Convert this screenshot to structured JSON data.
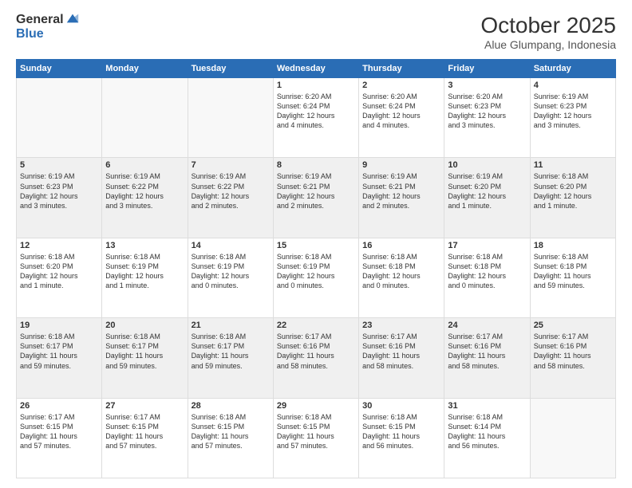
{
  "logo": {
    "general": "General",
    "blue": "Blue"
  },
  "title": {
    "month": "October 2025",
    "location": "Alue Glumpang, Indonesia"
  },
  "headers": [
    "Sunday",
    "Monday",
    "Tuesday",
    "Wednesday",
    "Thursday",
    "Friday",
    "Saturday"
  ],
  "weeks": [
    [
      {
        "day": "",
        "info": ""
      },
      {
        "day": "",
        "info": ""
      },
      {
        "day": "",
        "info": ""
      },
      {
        "day": "1",
        "info": "Sunrise: 6:20 AM\nSunset: 6:24 PM\nDaylight: 12 hours\nand 4 minutes."
      },
      {
        "day": "2",
        "info": "Sunrise: 6:20 AM\nSunset: 6:24 PM\nDaylight: 12 hours\nand 4 minutes."
      },
      {
        "day": "3",
        "info": "Sunrise: 6:20 AM\nSunset: 6:23 PM\nDaylight: 12 hours\nand 3 minutes."
      },
      {
        "day": "4",
        "info": "Sunrise: 6:19 AM\nSunset: 6:23 PM\nDaylight: 12 hours\nand 3 minutes."
      }
    ],
    [
      {
        "day": "5",
        "info": "Sunrise: 6:19 AM\nSunset: 6:23 PM\nDaylight: 12 hours\nand 3 minutes."
      },
      {
        "day": "6",
        "info": "Sunrise: 6:19 AM\nSunset: 6:22 PM\nDaylight: 12 hours\nand 3 minutes."
      },
      {
        "day": "7",
        "info": "Sunrise: 6:19 AM\nSunset: 6:22 PM\nDaylight: 12 hours\nand 2 minutes."
      },
      {
        "day": "8",
        "info": "Sunrise: 6:19 AM\nSunset: 6:21 PM\nDaylight: 12 hours\nand 2 minutes."
      },
      {
        "day": "9",
        "info": "Sunrise: 6:19 AM\nSunset: 6:21 PM\nDaylight: 12 hours\nand 2 minutes."
      },
      {
        "day": "10",
        "info": "Sunrise: 6:19 AM\nSunset: 6:20 PM\nDaylight: 12 hours\nand 1 minute."
      },
      {
        "day": "11",
        "info": "Sunrise: 6:18 AM\nSunset: 6:20 PM\nDaylight: 12 hours\nand 1 minute."
      }
    ],
    [
      {
        "day": "12",
        "info": "Sunrise: 6:18 AM\nSunset: 6:20 PM\nDaylight: 12 hours\nand 1 minute."
      },
      {
        "day": "13",
        "info": "Sunrise: 6:18 AM\nSunset: 6:19 PM\nDaylight: 12 hours\nand 1 minute."
      },
      {
        "day": "14",
        "info": "Sunrise: 6:18 AM\nSunset: 6:19 PM\nDaylight: 12 hours\nand 0 minutes."
      },
      {
        "day": "15",
        "info": "Sunrise: 6:18 AM\nSunset: 6:19 PM\nDaylight: 12 hours\nand 0 minutes."
      },
      {
        "day": "16",
        "info": "Sunrise: 6:18 AM\nSunset: 6:18 PM\nDaylight: 12 hours\nand 0 minutes."
      },
      {
        "day": "17",
        "info": "Sunrise: 6:18 AM\nSunset: 6:18 PM\nDaylight: 12 hours\nand 0 minutes."
      },
      {
        "day": "18",
        "info": "Sunrise: 6:18 AM\nSunset: 6:18 PM\nDaylight: 11 hours\nand 59 minutes."
      }
    ],
    [
      {
        "day": "19",
        "info": "Sunrise: 6:18 AM\nSunset: 6:17 PM\nDaylight: 11 hours\nand 59 minutes."
      },
      {
        "day": "20",
        "info": "Sunrise: 6:18 AM\nSunset: 6:17 PM\nDaylight: 11 hours\nand 59 minutes."
      },
      {
        "day": "21",
        "info": "Sunrise: 6:18 AM\nSunset: 6:17 PM\nDaylight: 11 hours\nand 59 minutes."
      },
      {
        "day": "22",
        "info": "Sunrise: 6:17 AM\nSunset: 6:16 PM\nDaylight: 11 hours\nand 58 minutes."
      },
      {
        "day": "23",
        "info": "Sunrise: 6:17 AM\nSunset: 6:16 PM\nDaylight: 11 hours\nand 58 minutes."
      },
      {
        "day": "24",
        "info": "Sunrise: 6:17 AM\nSunset: 6:16 PM\nDaylight: 11 hours\nand 58 minutes."
      },
      {
        "day": "25",
        "info": "Sunrise: 6:17 AM\nSunset: 6:16 PM\nDaylight: 11 hours\nand 58 minutes."
      }
    ],
    [
      {
        "day": "26",
        "info": "Sunrise: 6:17 AM\nSunset: 6:15 PM\nDaylight: 11 hours\nand 57 minutes."
      },
      {
        "day": "27",
        "info": "Sunrise: 6:17 AM\nSunset: 6:15 PM\nDaylight: 11 hours\nand 57 minutes."
      },
      {
        "day": "28",
        "info": "Sunrise: 6:18 AM\nSunset: 6:15 PM\nDaylight: 11 hours\nand 57 minutes."
      },
      {
        "day": "29",
        "info": "Sunrise: 6:18 AM\nSunset: 6:15 PM\nDaylight: 11 hours\nand 57 minutes."
      },
      {
        "day": "30",
        "info": "Sunrise: 6:18 AM\nSunset: 6:15 PM\nDaylight: 11 hours\nand 56 minutes."
      },
      {
        "day": "31",
        "info": "Sunrise: 6:18 AM\nSunset: 6:14 PM\nDaylight: 11 hours\nand 56 minutes."
      },
      {
        "day": "",
        "info": ""
      }
    ]
  ]
}
